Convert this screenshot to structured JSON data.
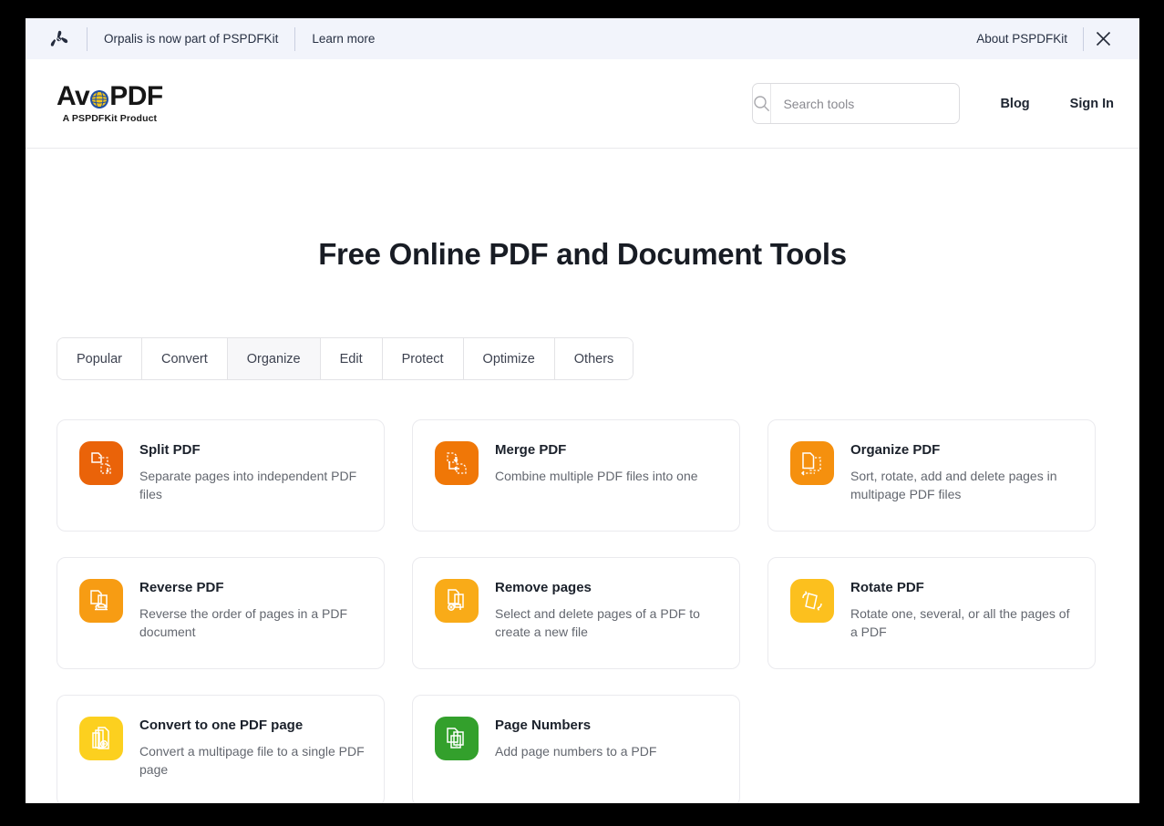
{
  "banner": {
    "logo_icon": "pspdfkit-propeller-icon",
    "message": "Orpalis is now part of PSPDFKit",
    "learn_more": "Learn more",
    "about": "About PSPDFKit",
    "close_icon": "close-icon",
    "background": "#f2f4fb"
  },
  "header": {
    "brand": {
      "text_before": "Av",
      "text_after": "PDF",
      "globe_icon": "globe-icon",
      "tagline": "A PSPDFKit Product"
    },
    "search": {
      "placeholder": "Search tools",
      "value": "",
      "icon": "search-icon"
    },
    "nav": [
      {
        "label": "Blog"
      },
      {
        "label": "Sign In"
      }
    ]
  },
  "main": {
    "title": "Free Online PDF and Document Tools",
    "tabs": [
      {
        "label": "Popular",
        "active": false
      },
      {
        "label": "Convert",
        "active": false
      },
      {
        "label": "Organize",
        "active": true
      },
      {
        "label": "Edit",
        "active": false
      },
      {
        "label": "Protect",
        "active": false
      },
      {
        "label": "Optimize",
        "active": false
      },
      {
        "label": "Others",
        "active": false
      }
    ],
    "tools": [
      {
        "title": "Split PDF",
        "desc": "Separate pages into independent PDF files",
        "icon": "split-pdf-icon",
        "color": "#ea6309"
      },
      {
        "title": "Merge PDF",
        "desc": "Combine multiple PDF files into one",
        "icon": "merge-pdf-icon",
        "color": "#f07707"
      },
      {
        "title": "Organize PDF",
        "desc": "Sort, rotate, add and delete pages in multipage PDF files",
        "icon": "organize-pdf-icon",
        "color": "#f5900e"
      },
      {
        "title": "Reverse PDF",
        "desc": "Reverse the order of pages in a PDF document",
        "icon": "reverse-pdf-icon",
        "color": "#f79c13"
      },
      {
        "title": "Remove pages",
        "desc": "Select and delete pages of a PDF to create a new file",
        "icon": "remove-pages-icon",
        "color": "#f9ab18"
      },
      {
        "title": "Rotate PDF",
        "desc": "Rotate one, several, or all the pages of a PDF",
        "icon": "rotate-pdf-icon",
        "color": "#fcc01e"
      },
      {
        "title": "Convert to one PDF page",
        "desc": "Convert a multipage file to a single PDF page",
        "icon": "convert-one-page-icon",
        "color": "#fcd01f"
      },
      {
        "title": "Page Numbers",
        "desc": "Add page numbers to a PDF",
        "icon": "page-numbers-icon",
        "color": "#33a02c"
      }
    ]
  }
}
